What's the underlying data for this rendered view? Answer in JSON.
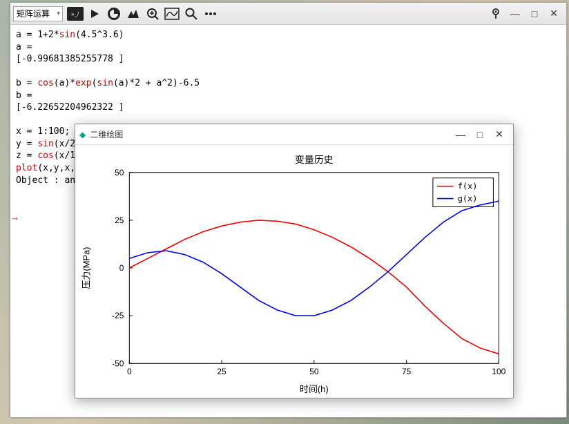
{
  "toolbar": {
    "dropdown_label": "矩阵运算",
    "icons": [
      "console-icon",
      "play-icon",
      "pie-icon",
      "mountain-icon",
      "zoom-plot-icon",
      "curve-icon",
      "search-icon",
      "more-icon"
    ]
  },
  "win": {
    "pin": "⎈",
    "minimize": "—",
    "maximize": "□",
    "close": "✕"
  },
  "console_lines": [
    {
      "segs": [
        {
          "t": "a = 1+2*"
        },
        {
          "t": "sin",
          "kw": 1
        },
        {
          "t": "(4.5^3.6)"
        }
      ]
    },
    {
      "segs": [
        {
          "t": "a ="
        }
      ]
    },
    {
      "segs": [
        {
          "t": "[-0.99681385255778 ]"
        }
      ]
    },
    {
      "segs": [
        {
          "t": ""
        }
      ]
    },
    {
      "segs": [
        {
          "t": "b = "
        },
        {
          "t": "cos",
          "kw": 1
        },
        {
          "t": "(a)*"
        },
        {
          "t": "exp",
          "kw": 1
        },
        {
          "t": "("
        },
        {
          "t": "sin",
          "kw": 1
        },
        {
          "t": "(a)*2 + a^2)-6.5"
        }
      ]
    },
    {
      "segs": [
        {
          "t": "b ="
        }
      ]
    },
    {
      "segs": [
        {
          "t": "[-6.22652204962322 ]"
        }
      ]
    },
    {
      "segs": [
        {
          "t": ""
        }
      ]
    },
    {
      "segs": [
        {
          "t": "x = 1:100;"
        }
      ]
    },
    {
      "segs": [
        {
          "t": "y = "
        },
        {
          "t": "sin",
          "kw": 1
        },
        {
          "t": "(x/20"
        }
      ]
    },
    {
      "segs": [
        {
          "t": "z = "
        },
        {
          "t": "cos",
          "kw": 1
        },
        {
          "t": "(x/1"
        }
      ]
    },
    {
      "segs": [
        {
          "t": "plot",
          "kw": 1
        },
        {
          "t": "(x,y,x,z)"
        }
      ]
    },
    {
      "segs": [
        {
          "t": "Object : an"
        }
      ]
    }
  ],
  "plot_window": {
    "title": "二维绘图",
    "minimize": "—",
    "maximize": "□",
    "close": "✕"
  },
  "chart_data": {
    "type": "line",
    "title": "变量历史",
    "xlabel": "时间(h)",
    "ylabel": "压力(MPa)",
    "xlim": [
      0,
      100
    ],
    "ylim": [
      -50,
      50
    ],
    "xticks": [
      0,
      25,
      50,
      75,
      100
    ],
    "yticks": [
      -50,
      -25,
      0,
      25,
      50
    ],
    "legend_position": "top-right",
    "series": [
      {
        "name": "f(x)",
        "color": "#e00",
        "x": [
          0,
          5,
          10,
          15,
          20,
          25,
          30,
          35,
          40,
          45,
          50,
          55,
          60,
          65,
          70,
          75,
          80,
          85,
          90,
          95,
          100
        ],
        "y": [
          0,
          5,
          10,
          15,
          19,
          22,
          24,
          25,
          24.5,
          23,
          20,
          16,
          11,
          5,
          -2,
          -10,
          -20,
          -29,
          -37,
          -42,
          -45
        ]
      },
      {
        "name": "g(x)",
        "color": "#00e",
        "x": [
          0,
          5,
          10,
          15,
          20,
          25,
          30,
          35,
          40,
          45,
          50,
          55,
          60,
          65,
          70,
          75,
          80,
          85,
          90,
          95,
          100
        ],
        "y": [
          5,
          8,
          9,
          7,
          3,
          -3,
          -10,
          -17,
          -22,
          -25,
          -25,
          -22,
          -17,
          -10,
          -2,
          7,
          16,
          24,
          30,
          33,
          35
        ]
      }
    ]
  }
}
